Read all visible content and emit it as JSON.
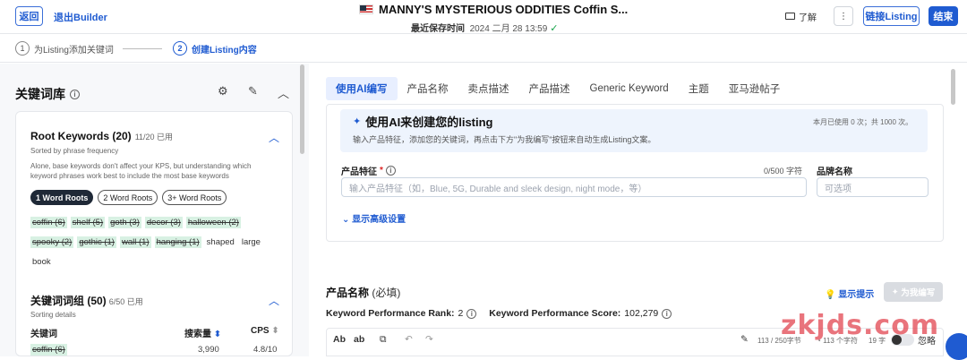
{
  "header": {
    "back": "返回",
    "exit": "退出Builder",
    "title": "MANNY'S MYSTERIOUS ODDITIES Coffin S...",
    "saved_label": "最近保存时间",
    "saved_time": "2024 二月 28 13:59",
    "learn": "了解",
    "more": "⋮",
    "link_listing": "链接Listing",
    "finish": "结束"
  },
  "steps": [
    {
      "num": "1",
      "label": "为Listing添加关键词"
    },
    {
      "num": "2",
      "label": "创建Listing内容"
    }
  ],
  "sidebar": {
    "title": "关键词库",
    "root": {
      "title": "Root Keywords (20)",
      "used": "11/20 已用",
      "sorted": "Sorted by phrase frequency",
      "desc": "Alone, base keywords don't affect your KPS, but understanding which keyword phrases work best to include the most base keywords",
      "pills": [
        "1 Word Roots",
        "2 Word Roots",
        "3+ Word Roots"
      ],
      "keywords": [
        {
          "text": "coffin (6)",
          "used": true
        },
        {
          "text": "shelf (5)",
          "used": true
        },
        {
          "text": "goth (3)",
          "used": true
        },
        {
          "text": "decor (3)",
          "used": true
        },
        {
          "text": "halloween (2)",
          "used": true
        },
        {
          "text": "spooky (2)",
          "used": true
        },
        {
          "text": "gothic (1)",
          "used": true
        },
        {
          "text": "wall (1)",
          "used": true
        },
        {
          "text": "hanging (1)",
          "used": true
        },
        {
          "text": "shaped",
          "used": false
        },
        {
          "text": "large",
          "used": false
        },
        {
          "text": "book",
          "used": false
        }
      ]
    },
    "group": {
      "title": "关键词词组 (50)",
      "used": "6/50 已用",
      "sorting": "Sorting details",
      "columns": [
        "关键词",
        "搜索量",
        "CPS"
      ],
      "row": {
        "keyword": "coffin (6)",
        "volume": "3,990",
        "cps": "4.8/10"
      }
    }
  },
  "tabs": [
    "使用AI编写",
    "产品名称",
    "卖点描述",
    "产品描述",
    "Generic Keyword",
    "主题",
    "亚马逊帖子"
  ],
  "ai": {
    "title": "使用AI来创建您的listing",
    "usage": "本月已使用 0 次；共 1000 次。",
    "desc": "输入产品特征，添加您的关键词，再点击下方\"为我编写\"按钮来自动生成Listing文案。",
    "feature_label": "产品特征",
    "required_mark": "*",
    "feature_count": "0/500 字符",
    "feature_placeholder": "输入产品特征（如，Blue, 5G, Durable and sleek design, night mode，等）",
    "brand_label": "品牌名称",
    "brand_placeholder": "可选项",
    "advanced": "显示高级设置"
  },
  "product_name": {
    "title": "产品名称",
    "required": "(必填)",
    "hint": "显示提示",
    "write_btn": "为我编写",
    "kpr_label": "Keyword Performance Rank:",
    "kpr_value": "2",
    "kps_label": "Keyword Performance Score:",
    "kps_value": "102,279",
    "toolbar": {
      "ab1": "Ab",
      "ab2": "ab"
    },
    "bytes": "113 / 250字节",
    "chars": "113 个字符",
    "chars2": "19 字",
    "ignore": "忽略"
  },
  "watermark": "zkjds.com"
}
